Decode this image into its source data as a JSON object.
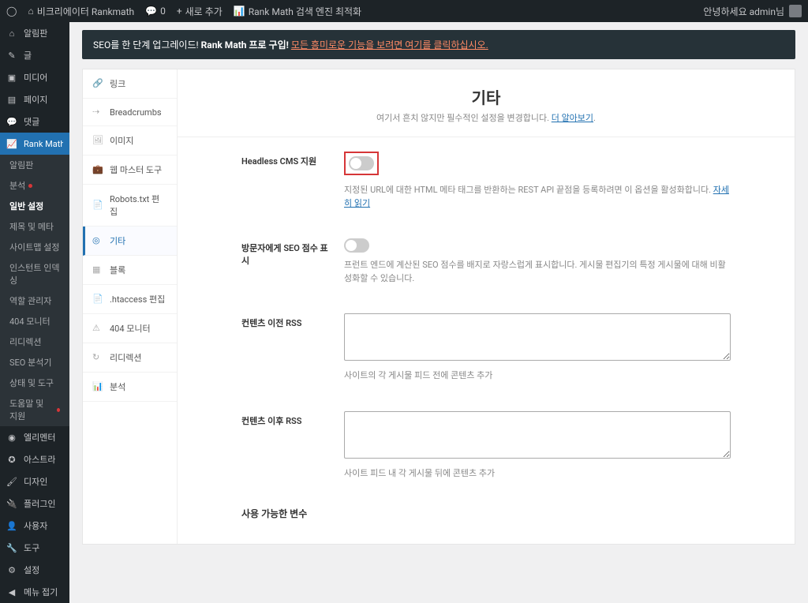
{
  "topbar": {
    "site_name": "비크리에이터 Rankmath",
    "comments": "0",
    "new": "새로 추가",
    "rankmath": "Rank Math 검색 엔진 최적화",
    "greeting": "안녕하세요 admin님"
  },
  "sidebar": {
    "items": [
      {
        "label": "알림판"
      },
      {
        "label": "글"
      },
      {
        "label": "미디어"
      },
      {
        "label": "페이지"
      },
      {
        "label": "댓글"
      },
      {
        "label": "Rank Math 검색 엔진 최적화"
      },
      {
        "label": "엘리멘터"
      },
      {
        "label": "아스트라"
      },
      {
        "label": "디자인"
      },
      {
        "label": "플러그인"
      },
      {
        "label": "사용자"
      },
      {
        "label": "도구"
      },
      {
        "label": "설정"
      },
      {
        "label": "메뉴 접기"
      }
    ]
  },
  "submenu": {
    "items": [
      "알림판",
      "분석",
      "일반 설정",
      "제목 및 메타",
      "사이트맵 설정",
      "인스턴트 인덱싱",
      "역할 관리자",
      "404 모니터",
      "리디렉션",
      "SEO 분석기",
      "상태 및 도구",
      "도움말 및 지원"
    ]
  },
  "notice": {
    "prefix": "SEO를 한 단계 업그레이드!",
    "strong": " Rank Math 프로 구입! ",
    "link": "모든 흥미로운 기능을 보려면 여기를 클릭하십시오."
  },
  "header": {
    "title": "기타",
    "subtitle": "여기서 흔치 않지만 필수적인 설정을 변경합니다. ",
    "more": "더 알아보기"
  },
  "tabs": {
    "items": [
      "링크",
      "Breadcrumbs",
      "이미지",
      "웹 마스터 도구",
      "Robots.txt 편집",
      "기타",
      "블록",
      ".htaccess 편집",
      "404 모니터",
      "리디렉션",
      "분석"
    ]
  },
  "fields": {
    "headless": {
      "label": "Headless CMS 지원",
      "help": "지정된 URL에 대한 HTML 메타 태그를 반환하는 REST API 끝점을 등록하려면 이 옵션을 활성화합니다. ",
      "help_link": "자세히 읽기"
    },
    "seo_score": {
      "label": "방문자에게 SEO 점수 표시",
      "help": "프런트 엔드에 계산된 SEO 점수를 배지로 자랑스럽게 표시합니다. 게시물 편집기의 특정 게시물에 대해 비활성화할 수 있습니다."
    },
    "rss_before": {
      "label": "컨텐츠 이전 RSS",
      "help": "사이트의 각 게시물 피드 전에 콘텐츠 추가"
    },
    "rss_after": {
      "label": "컨텐츠 이후 RSS",
      "help": "사이트 피드 내 각 게시물 뒤에 콘텐츠 추가"
    },
    "variables": {
      "label": "사용 가능한 변수"
    }
  }
}
